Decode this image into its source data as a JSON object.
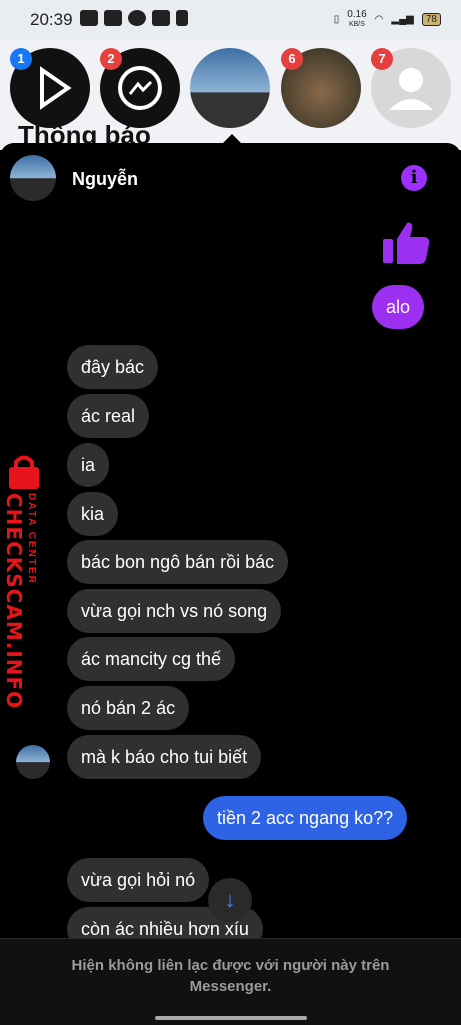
{
  "statusbar": {
    "time": "20:39",
    "net_speed": "0.16",
    "net_unit": "KB/S",
    "battery": "78"
  },
  "background": {
    "title": "Thông báo"
  },
  "bubbleheads": [
    {
      "badge": "1",
      "name": "video-bubble"
    },
    {
      "badge": "2",
      "name": "messenger-bubble"
    },
    {
      "badge": "",
      "name": "active-chat-bubble"
    },
    {
      "badge": "6",
      "name": "hamster-bubble"
    },
    {
      "badge": "7",
      "name": "default-user-bubble"
    }
  ],
  "chat": {
    "contact_name": "Nguyễn",
    "outgoing": {
      "alo": "alo",
      "blue": "tiền 2 acc ngang ko??"
    },
    "incoming": [
      "đây bác",
      "ác real",
      "ia",
      "kia",
      "bác bon ngô bán rồi bác",
      "vừa gọi nch vs nó song",
      "ác mancity cg thế",
      "nó bán 2 ác",
      "mà k báo cho tui biết"
    ],
    "incoming2": [
      "vừa gọi hỏi nó",
      "còn ác nhiều hơn xíu"
    ],
    "footer_notice": "Hiện không liên lạc được với người này trên Messenger."
  },
  "watermark": {
    "brand": "CHECKSCAM.INFO",
    "tag": "DATA CENTER"
  },
  "colors": {
    "purple": "#9b30f0",
    "blue": "#2e63e6",
    "incoming": "#303030"
  }
}
